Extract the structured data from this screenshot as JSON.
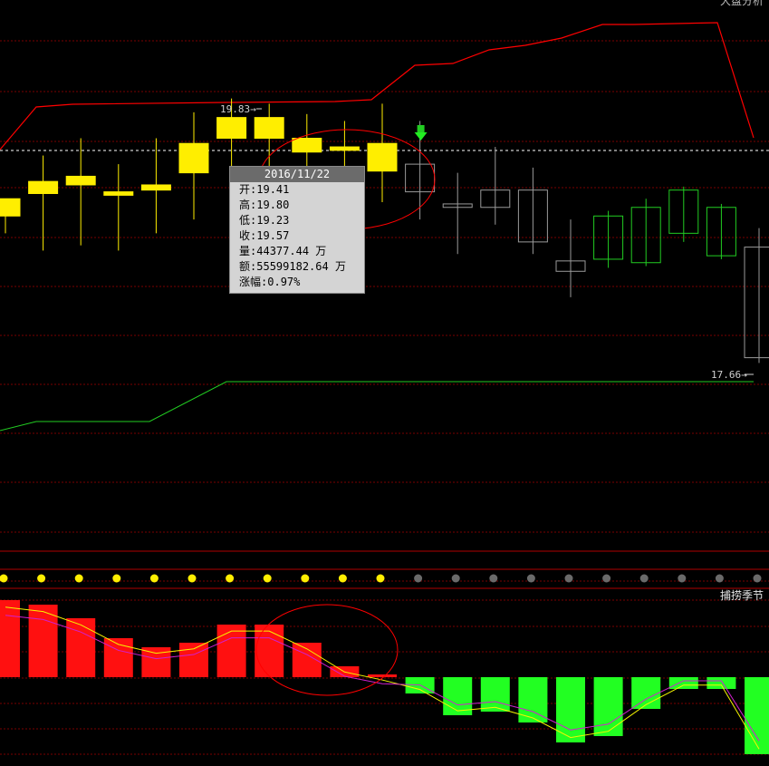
{
  "chart": {
    "top_right_label": "大盘分析",
    "indicator_panel_label": "捕捞季节",
    "high_marker": "19.83",
    "low_marker": "17.66",
    "arrow_glyph": "→"
  },
  "tooltip": {
    "date": "2016/11/22",
    "rows": [
      {
        "label": "开",
        "value": "19.41"
      },
      {
        "label": "高",
        "value": "19.80"
      },
      {
        "label": "低",
        "value": "19.23"
      },
      {
        "label": "收",
        "value": "19.57"
      },
      {
        "label": "量",
        "value": "44377.44 万"
      },
      {
        "label": "额",
        "value": "55599182.64 万"
      },
      {
        "label": "涨幅",
        "value": "0.97%"
      }
    ]
  },
  "colors": {
    "background": "#000000",
    "grid": "#7a0000",
    "up_yellow": "#ffee00",
    "down_gray": "#9a9a9a",
    "green": "#22cc22",
    "red": "#ff0000",
    "magenta": "#d020d0",
    "yellow_line": "#f5f500"
  },
  "chart_data": [
    {
      "type": "candlestick",
      "series": [
        {
          "name": "candles",
          "style": "ohlc",
          "values": [
            {
              "open": 19.15,
              "high": 19.15,
              "low": 19.05,
              "close": 19.25,
              "color": "yellow"
            },
            {
              "open": 19.28,
              "high": 19.5,
              "low": 18.95,
              "close": 19.35,
              "color": "yellow"
            },
            {
              "open": 19.33,
              "high": 19.6,
              "low": 18.98,
              "close": 19.38,
              "color": "yellow"
            },
            {
              "open": 19.27,
              "high": 19.45,
              "low": 18.95,
              "close": 19.29,
              "color": "yellow"
            },
            {
              "open": 19.3,
              "high": 19.6,
              "low": 19.05,
              "close": 19.33,
              "color": "yellow"
            },
            {
              "open": 19.4,
              "high": 19.75,
              "low": 19.13,
              "close": 19.57,
              "color": "yellow"
            },
            {
              "open": 19.6,
              "high": 19.83,
              "low": 19.38,
              "close": 19.72,
              "color": "yellow"
            },
            {
              "open": 19.6,
              "high": 19.8,
              "low": 19.23,
              "close": 19.72,
              "color": "yellow"
            },
            {
              "open": 19.52,
              "high": 19.74,
              "low": 19.33,
              "close": 19.6,
              "color": "yellow"
            },
            {
              "open": 19.53,
              "high": 19.7,
              "low": 19.28,
              "close": 19.55,
              "color": "yellow"
            },
            {
              "open": 19.41,
              "high": 19.8,
              "low": 19.23,
              "close": 19.57,
              "color": "yellow"
            },
            {
              "open": 19.45,
              "high": 19.7,
              "low": 19.13,
              "close": 19.29,
              "color": "gray"
            },
            {
              "open": 19.22,
              "high": 19.4,
              "low": 18.93,
              "close": 19.2,
              "color": "gray"
            },
            {
              "open": 19.3,
              "high": 19.55,
              "low": 19.1,
              "close": 19.2,
              "color": "gray"
            },
            {
              "open": 19.3,
              "high": 19.43,
              "low": 18.93,
              "close": 19.0,
              "color": "gray"
            },
            {
              "open": 18.89,
              "high": 19.13,
              "low": 18.68,
              "close": 18.83,
              "color": "gray"
            },
            {
              "open": 19.15,
              "high": 19.18,
              "low": 18.85,
              "close": 18.9,
              "color": "green"
            },
            {
              "open": 19.2,
              "high": 19.25,
              "low": 18.86,
              "close": 18.88,
              "color": "green"
            },
            {
              "open": 19.3,
              "high": 19.32,
              "low": 19.0,
              "close": 19.05,
              "color": "green"
            },
            {
              "open": 19.2,
              "high": 19.22,
              "low": 18.9,
              "close": 18.92,
              "color": "green"
            },
            {
              "open": 18.97,
              "high": 19.08,
              "low": 18.3,
              "close": 18.33,
              "color": "gray"
            }
          ]
        }
      ],
      "ylim": [
        17.2,
        20.4
      ],
      "annotations": {
        "high": "19.83",
        "low": "17.66"
      }
    },
    {
      "type": "bar",
      "series": [
        {
          "name": "histogram",
          "values": [
            85,
            80,
            65,
            43,
            33,
            38,
            58,
            58,
            38,
            12,
            3,
            -18,
            -42,
            -38,
            -50,
            -72,
            -65,
            -35,
            -13,
            -13,
            -85
          ]
        }
      ]
    }
  ]
}
